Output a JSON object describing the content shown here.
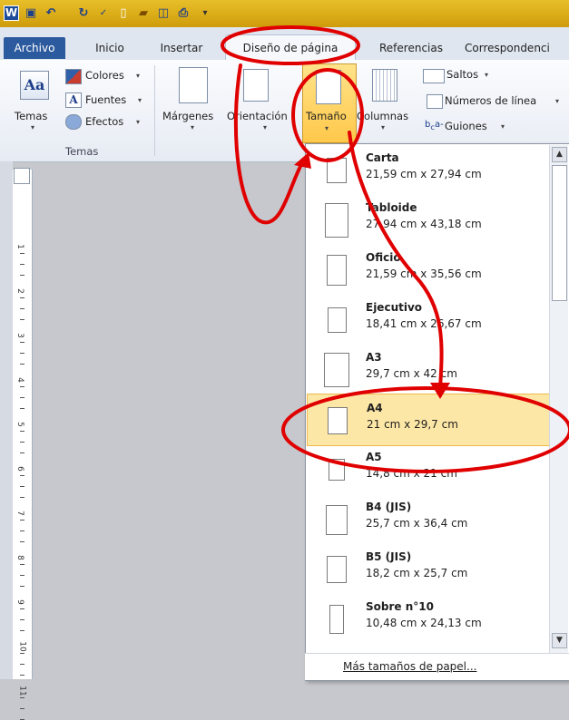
{
  "quick_access": {
    "app_icon": "W"
  },
  "tabs": {
    "file": "Archivo",
    "home": "Inicio",
    "insert": "Insertar",
    "layout": "Diseño de página",
    "references": "Referencias",
    "mailings": "Correspondenci"
  },
  "ribbon": {
    "themes_label": "Temas",
    "colors_label": "Colores",
    "fonts_label": "Fuentes",
    "effects_label": "Efectos",
    "group_themes": "Temas",
    "margins_label": "Márgenes",
    "orientation_label": "Orientación",
    "size_label": "Tamaño",
    "columns_label": "Columnas",
    "breaks_label": "Saltos",
    "line_numbers_label": "Números de línea",
    "hyphenation_label": "Guiones"
  },
  "ruler": {
    "numbers": [
      "1",
      "2",
      "3",
      "4",
      "5",
      "6",
      "7",
      "8",
      "9",
      "10",
      "11"
    ]
  },
  "size_menu": {
    "items": [
      {
        "name": "Carta",
        "size": "21,59 cm x 27,94 cm",
        "selected": false
      },
      {
        "name": "Tabloide",
        "size": "27,94 cm x 43,18 cm",
        "selected": false
      },
      {
        "name": "Oficio",
        "size": "21,59 cm x 35,56 cm",
        "selected": false
      },
      {
        "name": "Ejecutivo",
        "size": "18,41 cm x 26,67 cm",
        "selected": false
      },
      {
        "name": "A3",
        "size": "29,7 cm x 42 cm",
        "selected": false
      },
      {
        "name": "A4",
        "size": "21 cm x 29,7 cm",
        "selected": true
      },
      {
        "name": "A5",
        "size": "14,8 cm x 21 cm",
        "selected": false
      },
      {
        "name": "B4 (JIS)",
        "size": "25,7 cm x 36,4 cm",
        "selected": false
      },
      {
        "name": "B5 (JIS)",
        "size": "18,2 cm x 25,7 cm",
        "selected": false
      },
      {
        "name": "Sobre n°10",
        "size": "10,48 cm x 24,13 cm",
        "selected": false
      }
    ],
    "more_sizes": "Más tamaños de papel..."
  },
  "colors": {
    "annotation": "#e00000",
    "accent": "#2c5a9e",
    "selection": "#fde7a6"
  }
}
